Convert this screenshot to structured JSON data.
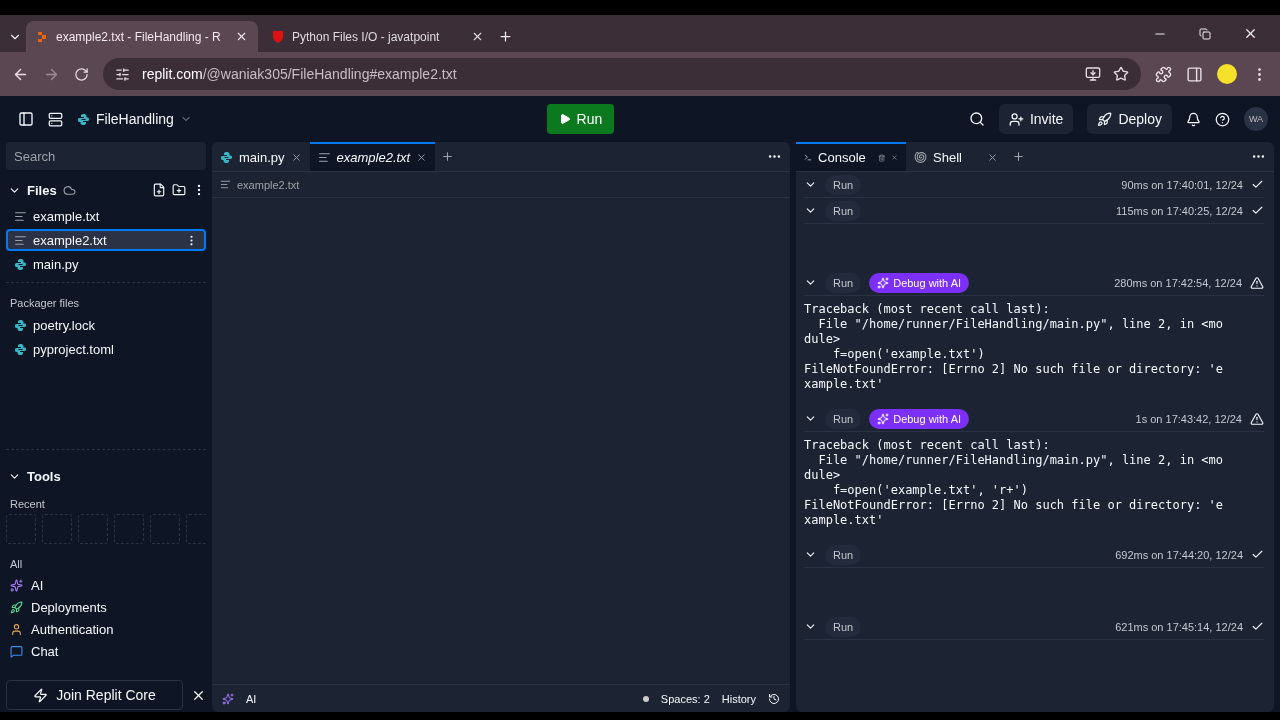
{
  "browser": {
    "tabs": [
      {
        "title": "example2.txt - FileHandling - R",
        "selected": true
      },
      {
        "title": "Python Files I/O - javatpoint",
        "selected": false
      }
    ],
    "url_host": "replit.com",
    "url_path": "/@waniak305/FileHandling#example2.txt"
  },
  "header": {
    "project": "FileHandling",
    "run": "Run",
    "invite": "Invite",
    "deploy": "Deploy",
    "avatar": "WA"
  },
  "sidebar": {
    "search": {
      "placeholder": "Search"
    },
    "files_title": "Files",
    "files_expanded": true,
    "files": [
      {
        "name": "example.txt",
        "kind": "text",
        "selected": false
      },
      {
        "name": "example2.txt",
        "kind": "text",
        "selected": true
      },
      {
        "name": "main.py",
        "kind": "python",
        "selected": false
      }
    ],
    "packager_title": "Packager files",
    "packager_files": [
      {
        "name": "poetry.lock",
        "kind": "python",
        "selected": false
      },
      {
        "name": "pyproject.toml",
        "kind": "python",
        "selected": false
      }
    ],
    "tools_title": "Tools",
    "tools_expanded": true,
    "recent_label": "Recent",
    "all_label": "All",
    "tools": [
      {
        "name": "AI"
      },
      {
        "name": "Deployments"
      },
      {
        "name": "Authentication"
      },
      {
        "name": "Chat"
      }
    ],
    "join": "Join Replit Core"
  },
  "editor": {
    "tabs": [
      {
        "label": "main.py",
        "kind": "python",
        "selected": false
      },
      {
        "label": "example2.txt",
        "kind": "text",
        "selected": true
      }
    ],
    "breadcrumb": "example2.txt",
    "status": {
      "ai": "AI",
      "spaces": "Spaces: 2",
      "history": "History"
    }
  },
  "console": {
    "tabs": [
      {
        "label": "Console",
        "selected": true
      },
      {
        "label": "Shell",
        "selected": false
      }
    ],
    "runs": [
      {
        "label": "Run",
        "time": "90ms on 17:40:01, 12/24",
        "failed": false
      },
      {
        "label": "Run",
        "time": "115ms on 17:40:25, 12/24",
        "failed": false
      },
      {
        "label": "Run",
        "debug": "Debug with AI",
        "time": "280ms on 17:42:54, 12/24",
        "failed": true,
        "output": [
          "Traceback (most recent call last):",
          "  File \"/home/runner/FileHandling/main.py\", line 2, in <mo",
          "dule>",
          "    f=open('example.txt')",
          "FileNotFoundError: [Errno 2] No such file or directory: 'e",
          "xample.txt'"
        ]
      },
      {
        "label": "Run",
        "debug": "Debug with AI",
        "time": "1s on 17:43:42, 12/24",
        "failed": true,
        "output": [
          "Traceback (most recent call last):",
          "  File \"/home/runner/FileHandling/main.py\", line 2, in <mo",
          "dule>",
          "    f=open('example.txt', 'r+')",
          "FileNotFoundError: [Errno 2] No such file or directory: 'e",
          "xample.txt'"
        ]
      },
      {
        "label": "Run",
        "time": "692ms on 17:44:20, 12/24",
        "failed": false
      },
      {
        "label": "Run",
        "time": "621ms on 17:45:14, 12/24",
        "failed": false
      }
    ]
  }
}
